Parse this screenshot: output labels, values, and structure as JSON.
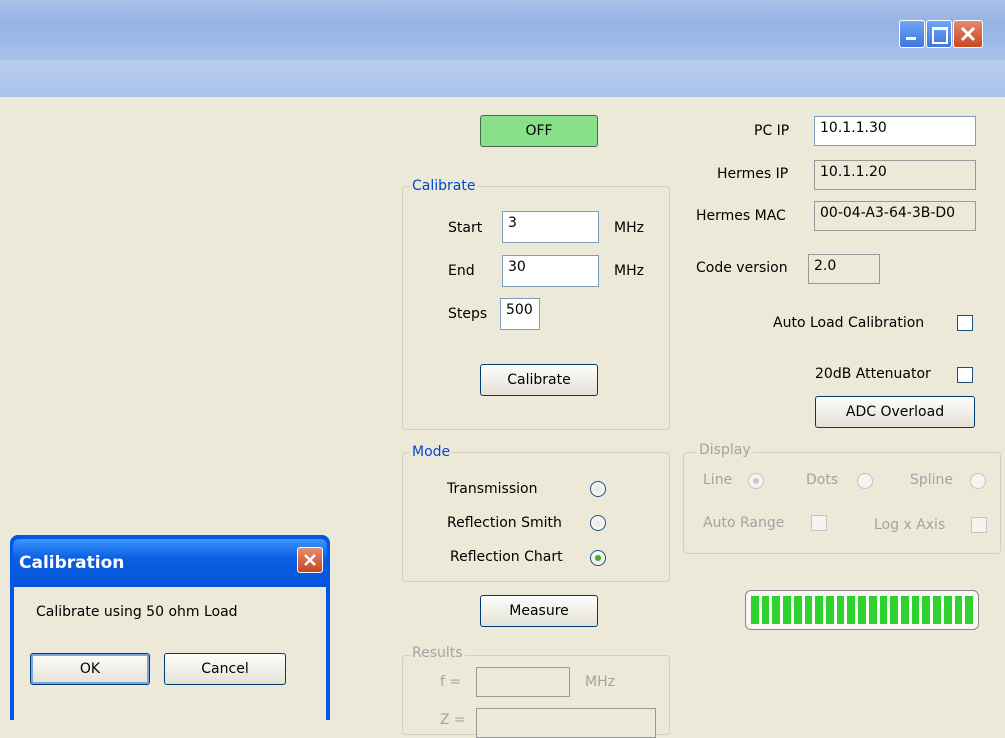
{
  "window": {
    "title": "",
    "minimize_icon": "minimize-icon",
    "maximize_icon": "maximize-icon",
    "close_icon": "close-icon"
  },
  "power_button": {
    "label": "OFF",
    "color": "#88e088"
  },
  "network": {
    "pc_ip_label": "PC IP",
    "pc_ip_value": "10.1.1.30",
    "hermes_ip_label": "Hermes IP",
    "hermes_ip_value": "10.1.1.20",
    "hermes_mac_label": "Hermes MAC",
    "hermes_mac_value": "00-04-A3-64-3B-D0",
    "code_version_label": "Code version",
    "code_version_value": "2.0"
  },
  "options": {
    "auto_load_label": "Auto Load Calibration",
    "attenuator_label": "20dB Attenuator",
    "adc_overload_label": "ADC Overload"
  },
  "calibrate_group": {
    "title": "Calibrate",
    "start_label": "Start",
    "start_value": "3",
    "end_label": "End",
    "end_value": "30",
    "unit": "MHz",
    "steps_label": "Steps",
    "steps_value": "500",
    "button_label": "Calibrate"
  },
  "mode_group": {
    "title": "Mode",
    "options": [
      "Transmission",
      "Reflection Smith",
      "Reflection Chart"
    ],
    "selected": "Reflection Chart"
  },
  "display_group": {
    "title": "Display",
    "line_label": "Line",
    "dots_label": "Dots",
    "spline_label": "Spline",
    "auto_range_label": "Auto Range",
    "log_x_label": "Log x Axis"
  },
  "measure_button": {
    "label": "Measure"
  },
  "results_group": {
    "title": "Results",
    "f_label": "f =",
    "f_unit": "MHz",
    "z_label": "Z ="
  },
  "level_meter": {
    "segments": 21,
    "lit_fraction": 1.0,
    "color": "#2fd12f"
  },
  "dialog": {
    "title": "Calibration",
    "message": "Calibrate using 50 ohm Load",
    "ok_label": "OK",
    "cancel_label": "Cancel",
    "close_icon": "close-icon"
  }
}
